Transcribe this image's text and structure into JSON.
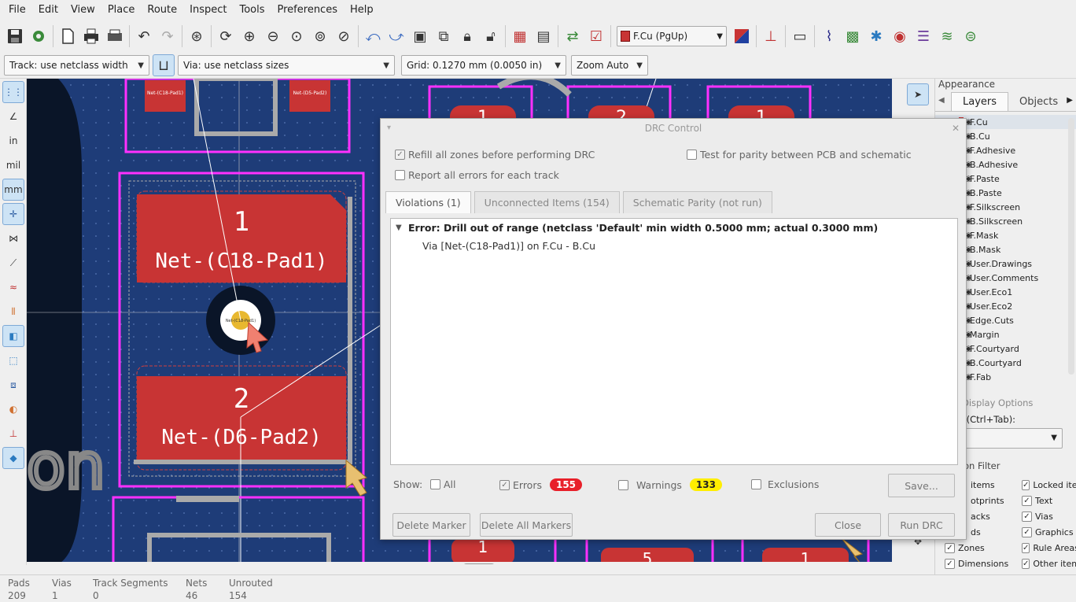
{
  "menu": [
    "File",
    "Edit",
    "View",
    "Place",
    "Route",
    "Inspect",
    "Tools",
    "Preferences",
    "Help"
  ],
  "toolbar": {
    "layer": "F.Cu (PgUp)"
  },
  "toolbar2": {
    "track": "Track: use netclass width",
    "via": "Via: use netclass sizes",
    "grid": "Grid: 0.1270 mm (0.0050 in)",
    "zoom": "Zoom Auto"
  },
  "left_tools": {
    "in": "in",
    "mil": "mil",
    "mm": "mm"
  },
  "canvas": {
    "pad1_num": "1",
    "pad1_net": "Net-(C18-Pad1)",
    "pad2_num": "2",
    "pad2_net": "Net-(D6-Pad2)",
    "top_pad_a": "Net-(C18-Pad1)",
    "top_pad_b": "Net-(D5-Pad2)",
    "via_label": "Net-(C18-Pad1)",
    "right_pad1": "1",
    "right_pad2": "2",
    "right_pad3": "1",
    "bottom_pad_a": "1",
    "bottom_pad_b": "5",
    "bottom_pad_c": "1"
  },
  "appearance": {
    "title": "Appearance",
    "tab_layers": "Layers",
    "tab_objects": "Objects",
    "layers": [
      {
        "name": "F.Cu",
        "color": "#c83434"
      },
      {
        "name": "B.Cu",
        "color": "#4d7fc4"
      },
      {
        "name": "F.Adhesive",
        "color": "#8a3ea0"
      },
      {
        "name": "B.Adhesive",
        "color": "#2e5fa0"
      },
      {
        "name": "F.Paste",
        "color": "#b45050"
      },
      {
        "name": "B.Paste",
        "color": "#2e9090"
      },
      {
        "name": "F.Silkscreen",
        "color": "#e0e0e0"
      },
      {
        "name": "B.Silkscreen",
        "color": "#e8b4e8"
      },
      {
        "name": "F.Mask",
        "color": "#d050a0"
      },
      {
        "name": "B.Mask",
        "color": "#20a0a0"
      },
      {
        "name": "User.Drawings",
        "color": "#d0d0d0"
      },
      {
        "name": "User.Comments",
        "color": "#8080ff"
      },
      {
        "name": "User.Eco1",
        "color": "#50d050"
      },
      {
        "name": "User.Eco2",
        "color": "#c0c050"
      },
      {
        "name": "Edge.Cuts",
        "color": "#e0e050"
      },
      {
        "name": "Margin",
        "color": "#e050e0"
      },
      {
        "name": "F.Courtyard",
        "color": "#ff40ff"
      },
      {
        "name": "B.Courtyard",
        "color": "#40ffff"
      },
      {
        "name": "F.Fab",
        "color": "#aaaaaa"
      },
      {
        "name": "B.Fab",
        "color": "#5555dd"
      }
    ],
    "display_options": "Display Options",
    "preset_label": "s (Ctrl+Tab):",
    "selection_filter": "on Filter",
    "filters_left": [
      "items",
      "otprints",
      "acks",
      "ds",
      "Zones",
      "Dimensions"
    ],
    "filters_right": [
      "Locked ite",
      "Text",
      "Vias",
      "Graphics",
      "Rule Areas",
      "Other item"
    ]
  },
  "status": {
    "pads_label": "Pads",
    "pads": "209",
    "vias_label": "Vias",
    "vias": "1",
    "tracks_label": "Track Segments",
    "tracks": "0",
    "nets_label": "Nets",
    "nets": "46",
    "unrouted_label": "Unrouted",
    "unrouted": "154"
  },
  "dialog": {
    "title": "DRC Control",
    "refill": "Refill all zones before performing DRC",
    "parity": "Test for parity between PCB and schematic",
    "report_all": "Report all errors for each track",
    "tab_violations": "Violations (1)",
    "tab_unconnected": "Unconnected Items (154)",
    "tab_parity": "Schematic Parity (not run)",
    "error": "Error: Drill out of range (netclass 'Default' min width 0.5000 mm; actual 0.3000 mm)",
    "error_item": "Via [Net-(C18-Pad1)] on F.Cu - B.Cu",
    "show_label": "Show:",
    "show_all": "All",
    "show_errors": "Errors",
    "errors_count": "155",
    "show_warnings": "Warnings",
    "warnings_count": "133",
    "show_exclusions": "Exclusions",
    "save": "Save...",
    "delete_marker": "Delete Marker",
    "delete_all": "Delete All Markers",
    "close": "Close",
    "run": "Run DRC",
    "colors": {
      "error_badge": "#e8202a",
      "warning_badge": "#ffee00"
    }
  }
}
